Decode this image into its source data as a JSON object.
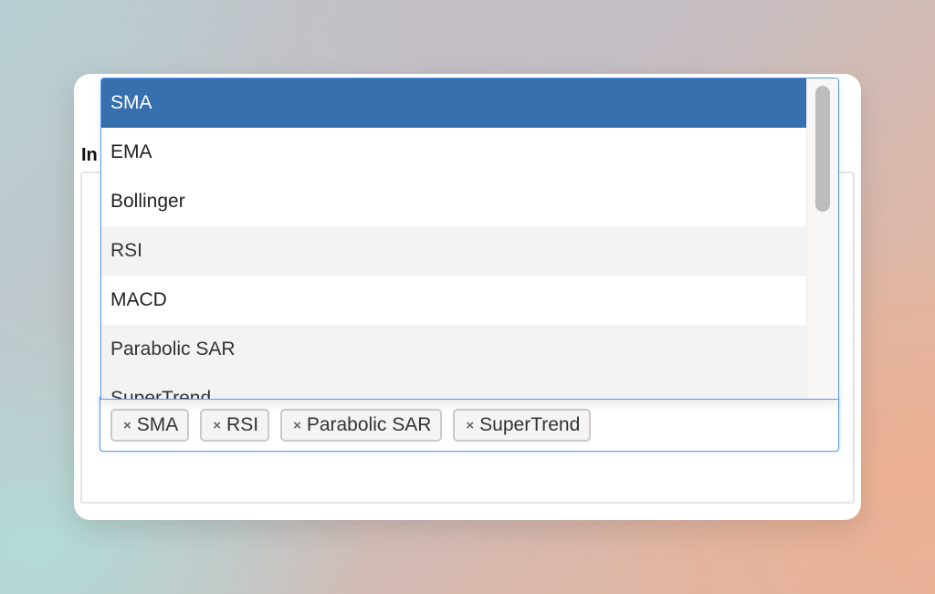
{
  "field": {
    "label": "In"
  },
  "dropdown": {
    "options": [
      {
        "label": "SMA",
        "state": "highlighted"
      },
      {
        "label": "EMA",
        "state": "normal"
      },
      {
        "label": "Bollinger",
        "state": "normal"
      },
      {
        "label": "RSI",
        "state": "selected"
      },
      {
        "label": "MACD",
        "state": "normal"
      },
      {
        "label": "Parabolic SAR",
        "state": "selected"
      },
      {
        "label": "SuperTrend",
        "state": "selected"
      }
    ]
  },
  "selection": {
    "remove_symbol": "×",
    "chips": [
      {
        "label": "SMA"
      },
      {
        "label": "RSI"
      },
      {
        "label": "Parabolic SAR"
      },
      {
        "label": "SuperTrend"
      }
    ]
  },
  "colors": {
    "highlight": "#3670ae",
    "focus_border": "#5897fb",
    "selected_option_bg": "#f3f3f3"
  }
}
